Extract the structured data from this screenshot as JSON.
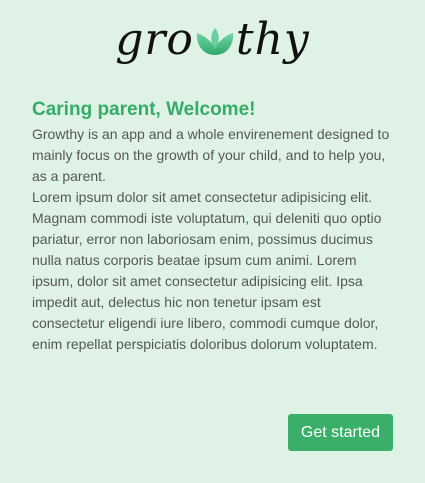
{
  "logo": {
    "text_left": "gro",
    "text_right": "thy",
    "icon": "lotus-leaf-icon",
    "leaf_color": "#4cc08a"
  },
  "welcome": {
    "title": "Caring parent, Welcome!",
    "intro": "Growthy is an app and a whole envirenement designed to mainly focus on the growth of your child, and to help you, as a parent.",
    "body": "Lorem ipsum dolor sit amet consectetur adipisicing elit. Magnam commodi iste voluptatum, qui deleniti quo optio pariatur, error non laboriosam enim, possimus ducimus nulla natus corporis beatae ipsum cum animi. Lorem ipsum, dolor sit amet consectetur adipisicing elit. Ipsa impedit aut, delectus hic non tenetur ipsam est consectetur eligendi iure libero, commodi cumque dolor, enim repellat perspiciatis doloribus dolorum voluptatem."
  },
  "actions": {
    "get_started_label": "Get started"
  },
  "colors": {
    "background": "#dff2e6",
    "accent": "#35ad66",
    "button": "#3aaf6a",
    "text": "#545855"
  }
}
